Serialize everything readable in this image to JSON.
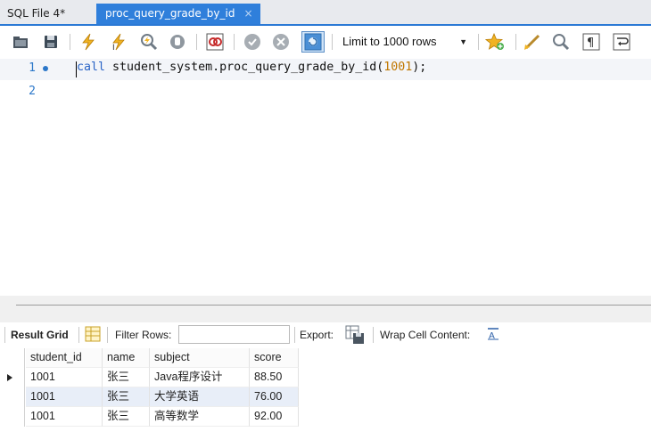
{
  "tabs": [
    {
      "label": "SQL File 4*",
      "active": false
    },
    {
      "label": "proc_query_grade_by_id",
      "active": true,
      "close": "×"
    }
  ],
  "toolbar": {
    "limit_select": "Limit to 1000 rows",
    "icons": [
      "open-folder-icon",
      "save-icon",
      "execute-lightning-icon",
      "execute-current-icon",
      "explain-icon",
      "stop-icon",
      "toggle-error-icon",
      "commit-icon",
      "rollback-icon",
      "autocommit-icon",
      "beautify-star-icon",
      "brush-icon",
      "find-icon",
      "invisible-chars-icon",
      "wrap-icon"
    ]
  },
  "editor": {
    "lines": [
      {
        "number": "1",
        "breakpoint": true
      },
      {
        "number": "2",
        "breakpoint": false
      }
    ],
    "code": {
      "keyword": "call",
      "body": " student_system.proc_query_grade_by_id(",
      "arg": "1001",
      "tail": ");"
    }
  },
  "result_toolbar": {
    "result_grid": "Result Grid",
    "filter_rows": "Filter Rows:",
    "export": "Export:",
    "wrap_cell": "Wrap Cell Content:"
  },
  "grid": {
    "columns": [
      "student_id",
      "name",
      "subject",
      "score"
    ],
    "rows": [
      [
        "1001",
        "张三",
        "Java程序设计",
        "88.50"
      ],
      [
        "1001",
        "张三",
        "大学英语",
        "76.00"
      ],
      [
        "1001",
        "张三",
        "高等数学",
        "92.00"
      ]
    ]
  },
  "colors": {
    "accent": "#2f7fdb",
    "keyword": "#2a64c6",
    "number": "#c07700"
  }
}
